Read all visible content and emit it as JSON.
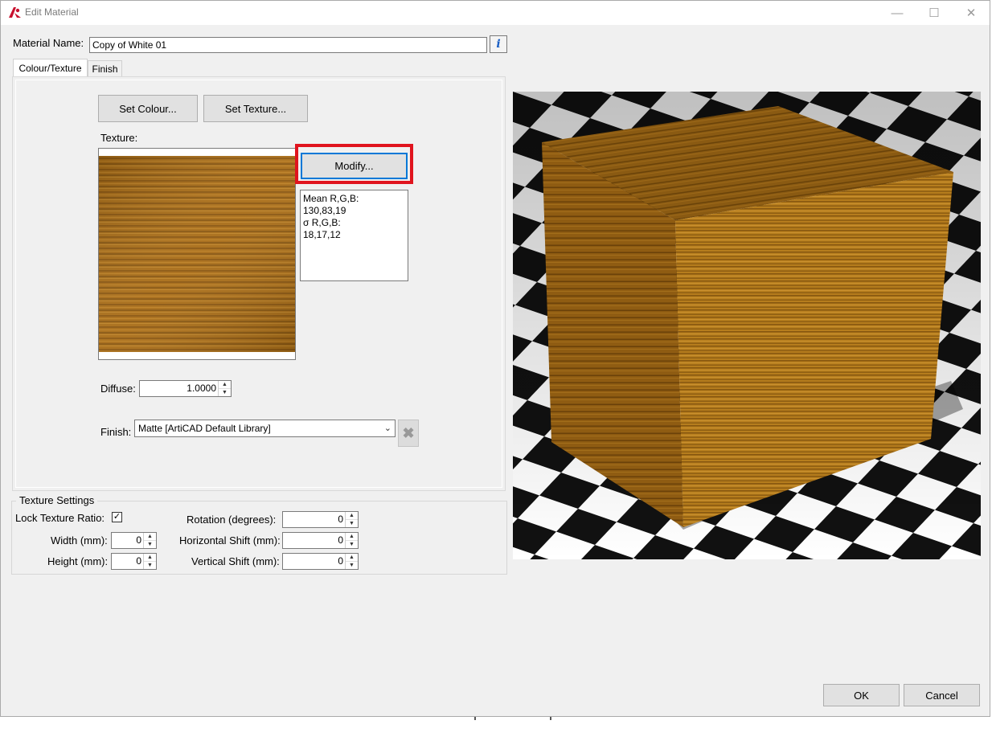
{
  "window": {
    "title": "Edit Material",
    "controls": {
      "minimize": "—",
      "maximize": "☐",
      "close": "✕"
    }
  },
  "material_name": {
    "label": "Material Name:",
    "value": "Copy of White 01",
    "info": "i"
  },
  "tabs": [
    {
      "label": "Colour/Texture",
      "active": true
    },
    {
      "label": "Finish",
      "active": false
    }
  ],
  "colour_texture": {
    "set_colour_label": "Set Colour...",
    "set_texture_label": "Set Texture...",
    "texture_label": "Texture:",
    "modify_label": "Modify...",
    "stats": {
      "mean_label": "Mean R,G,B:",
      "mean_value": "130,83,19",
      "sigma_label": "σ R,G,B:",
      "sigma_value": "18,17,12"
    },
    "diffuse_label": "Diffuse:",
    "diffuse_value": "1.0000",
    "finish_label": "Finish:",
    "finish_value": "Matte [ArtiCAD Default Library]"
  },
  "texture_settings": {
    "title": "Texture Settings",
    "lock_ratio_label": "Lock Texture Ratio:",
    "lock_ratio_checked": true,
    "width_label": "Width (mm):",
    "width_value": "0",
    "height_label": "Height (mm):",
    "height_value": "0",
    "rotation_label": "Rotation (degrees):",
    "rotation_value": "0",
    "hshift_label": "Horizontal Shift (mm):",
    "hshift_value": "0",
    "vshift_label": "Vertical Shift (mm):",
    "vshift_value": "0"
  },
  "footer": {
    "ok_label": "OK",
    "cancel_label": "Cancel"
  },
  "colors": {
    "highlight": "#e0141e",
    "focus": "#0078d7",
    "wood_base": "#b57a1c",
    "wood_dark": "#6e4309",
    "app_icon": "#c8102e"
  }
}
